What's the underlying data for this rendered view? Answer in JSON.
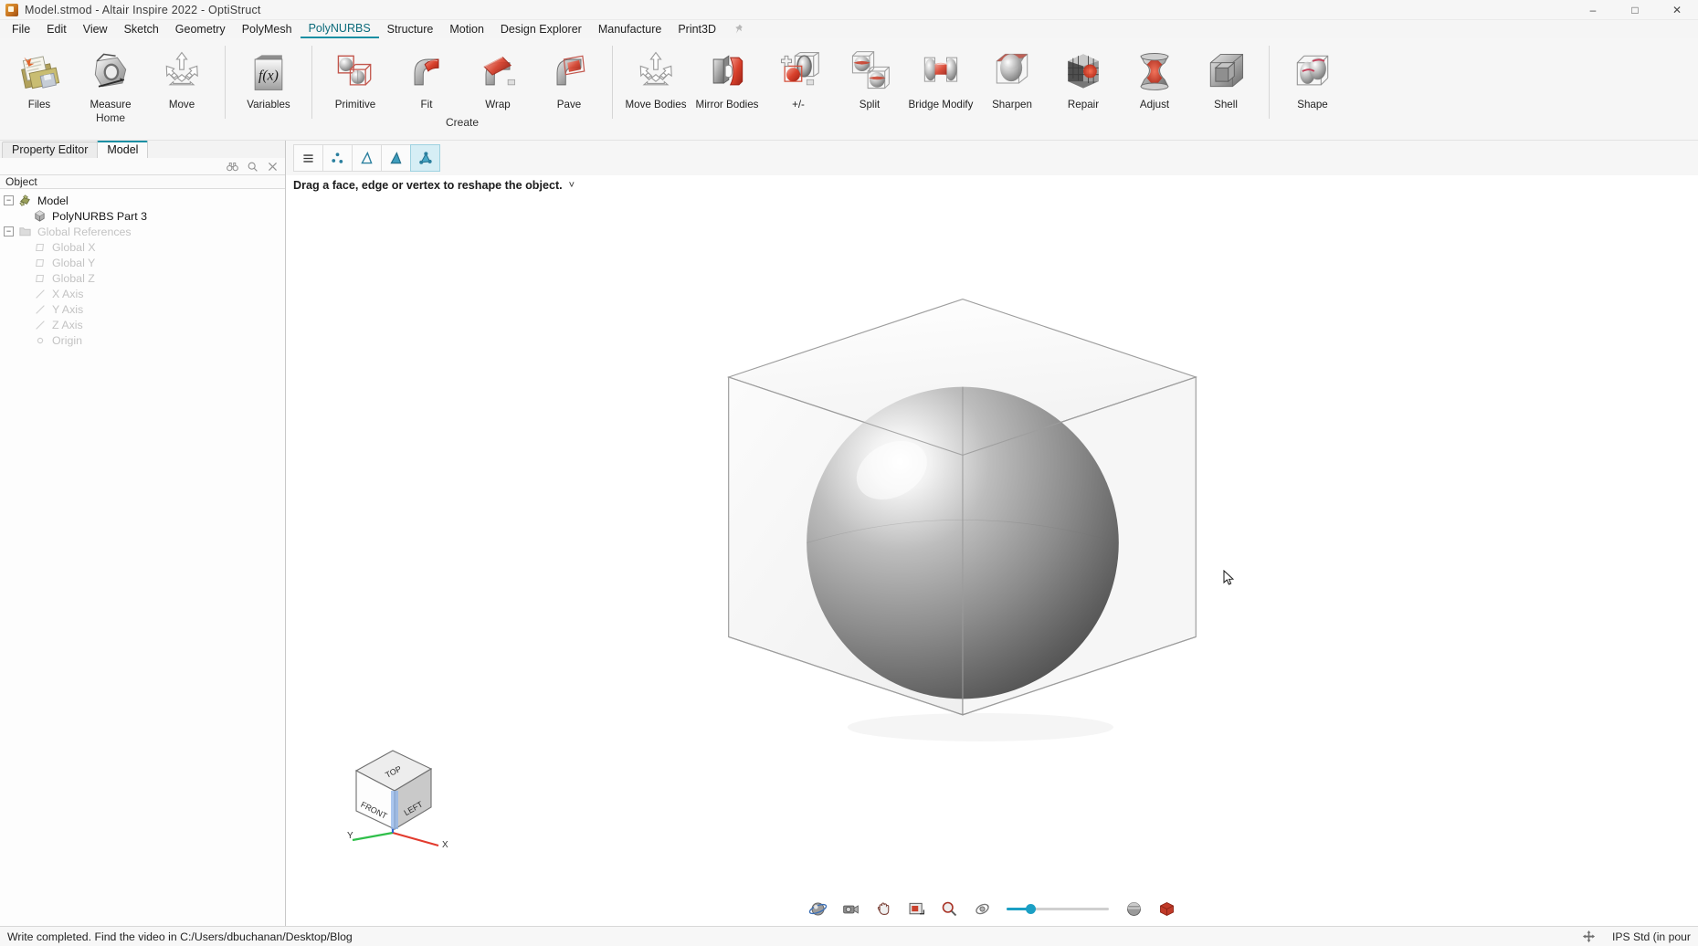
{
  "window": {
    "title": "Model.stmod - Altair Inspire 2022 - OptiStruct",
    "app_icon": "altair-logo-icon",
    "minimize": "–",
    "maximize": "□",
    "close": "✕"
  },
  "menubar": {
    "items": [
      {
        "label": "File",
        "active": false
      },
      {
        "label": "Edit",
        "active": false
      },
      {
        "label": "View",
        "active": false
      },
      {
        "label": "Sketch",
        "active": false
      },
      {
        "label": "Geometry",
        "active": false
      },
      {
        "label": "PolyMesh",
        "active": false
      },
      {
        "label": "PolyNURBS",
        "active": true
      },
      {
        "label": "Structure",
        "active": false
      },
      {
        "label": "Motion",
        "active": false
      },
      {
        "label": "Design Explorer",
        "active": false
      },
      {
        "label": "Manufacture",
        "active": false
      },
      {
        "label": "Print3D",
        "active": false
      }
    ],
    "pin_icon": "pin-icon"
  },
  "ribbon": {
    "groups": [
      {
        "label": "Home",
        "accent": true,
        "buttons": [
          {
            "label": "Files",
            "icon": "files-icon"
          },
          {
            "label": "Measure",
            "icon": "measure-icon"
          },
          {
            "label": "Move",
            "icon": "move-icon"
          }
        ]
      },
      {
        "label": "",
        "accent": false,
        "buttons": [
          {
            "label": "Variables",
            "icon": "variables-fx-icon"
          }
        ]
      },
      {
        "label": "Create",
        "accent": false,
        "buttons": [
          {
            "label": "Primitive",
            "icon": "primitive-icon"
          },
          {
            "label": "Fit",
            "icon": "fit-icon"
          },
          {
            "label": "Wrap",
            "icon": "wrap-icon"
          },
          {
            "label": "Pave",
            "icon": "pave-icon"
          }
        ]
      },
      {
        "label": "",
        "accent": false,
        "buttons": [
          {
            "label": "Move Bodies",
            "icon": "move-bodies-icon"
          },
          {
            "label": "Mirror Bodies",
            "icon": "mirror-bodies-icon"
          },
          {
            "label": "+/-",
            "icon": "plus-minus-icon"
          },
          {
            "label": "Split",
            "icon": "split-icon"
          },
          {
            "label": "Bridge Modify",
            "icon": "bridge-modify-icon"
          },
          {
            "label": "Sharpen",
            "icon": "sharpen-icon"
          },
          {
            "label": "Repair",
            "icon": "repair-icon"
          },
          {
            "label": "Adjust",
            "icon": "adjust-icon"
          },
          {
            "label": "Shell",
            "icon": "shell-icon"
          }
        ]
      },
      {
        "label": "",
        "accent": false,
        "buttons": [
          {
            "label": "Shape",
            "icon": "shape-icon"
          }
        ]
      }
    ]
  },
  "left_panel": {
    "tabs": [
      {
        "label": "Property Editor",
        "active": false
      },
      {
        "label": "Model",
        "active": true
      }
    ],
    "tools": [
      {
        "icon": "binoculars-icon"
      },
      {
        "icon": "search-icon"
      },
      {
        "icon": "close-icon"
      }
    ],
    "object_header": "Object",
    "tree": [
      {
        "label": "Model",
        "icon": "model-root-icon",
        "indent": 0,
        "expander": "−",
        "dim": false
      },
      {
        "label": "PolyNURBS Part 3",
        "icon": "part-cube-icon",
        "indent": 1,
        "expander": "",
        "dim": false
      },
      {
        "label": "Global References",
        "icon": "folder-icon",
        "indent": 0,
        "expander": "−",
        "dim": true
      },
      {
        "label": "Global X",
        "icon": "plane-icon",
        "indent": 1,
        "expander": "",
        "dim": true
      },
      {
        "label": "Global Y",
        "icon": "plane-icon",
        "indent": 1,
        "expander": "",
        "dim": true
      },
      {
        "label": "Global Z",
        "icon": "plane-icon",
        "indent": 1,
        "expander": "",
        "dim": true
      },
      {
        "label": "X Axis",
        "icon": "axis-icon",
        "indent": 1,
        "expander": "",
        "dim": true
      },
      {
        "label": "Y Axis",
        "icon": "axis-icon",
        "indent": 1,
        "expander": "",
        "dim": true
      },
      {
        "label": "Z Axis",
        "icon": "axis-icon",
        "indent": 1,
        "expander": "",
        "dim": true
      },
      {
        "label": "Origin",
        "icon": "origin-icon",
        "indent": 1,
        "expander": "",
        "dim": true
      }
    ]
  },
  "sub_toolbar": {
    "buttons": [
      {
        "icon": "list-lines-icon",
        "selected": false
      },
      {
        "icon": "vertices-icon",
        "selected": false
      },
      {
        "icon": "face-outline-icon",
        "selected": false
      },
      {
        "icon": "face-filled-icon",
        "selected": false
      },
      {
        "icon": "body-nodes-icon",
        "selected": true
      }
    ]
  },
  "prompt": {
    "text": "Drag a face, edge or vertex to reshape the object.",
    "chevron": "˅"
  },
  "viewport": {
    "cursor_icon": "mouse-pointer-icon",
    "viewcube": {
      "top_label": "TOP",
      "front_label": "FRONT",
      "left_label": "LEFT",
      "x_label": "X",
      "y_label": "Y"
    }
  },
  "view_toolbar": {
    "buttons": [
      {
        "icon": "orbit-icon"
      },
      {
        "icon": "camera-icon"
      },
      {
        "icon": "pan-hand-icon"
      },
      {
        "icon": "fit-window-icon"
      },
      {
        "icon": "zoom-magnifier-icon"
      },
      {
        "icon": "rotate-view-icon"
      },
      {
        "icon": "section-plane-icon"
      }
    ],
    "slider": {
      "value": 20
    },
    "right_buttons": [
      {
        "icon": "shaded-sphere-icon"
      },
      {
        "icon": "render-cube-icon"
      }
    ]
  },
  "statusbar": {
    "message": "Write completed. Find the video in C:/Users/dbuchanan/Desktop/Blog",
    "move_icon": "move-cross-icon",
    "units": "IPS Std (in pour"
  },
  "colors": {
    "accent": "#1b8fa3",
    "slider": "#1b9fc4",
    "selection": "#d6eef5"
  }
}
